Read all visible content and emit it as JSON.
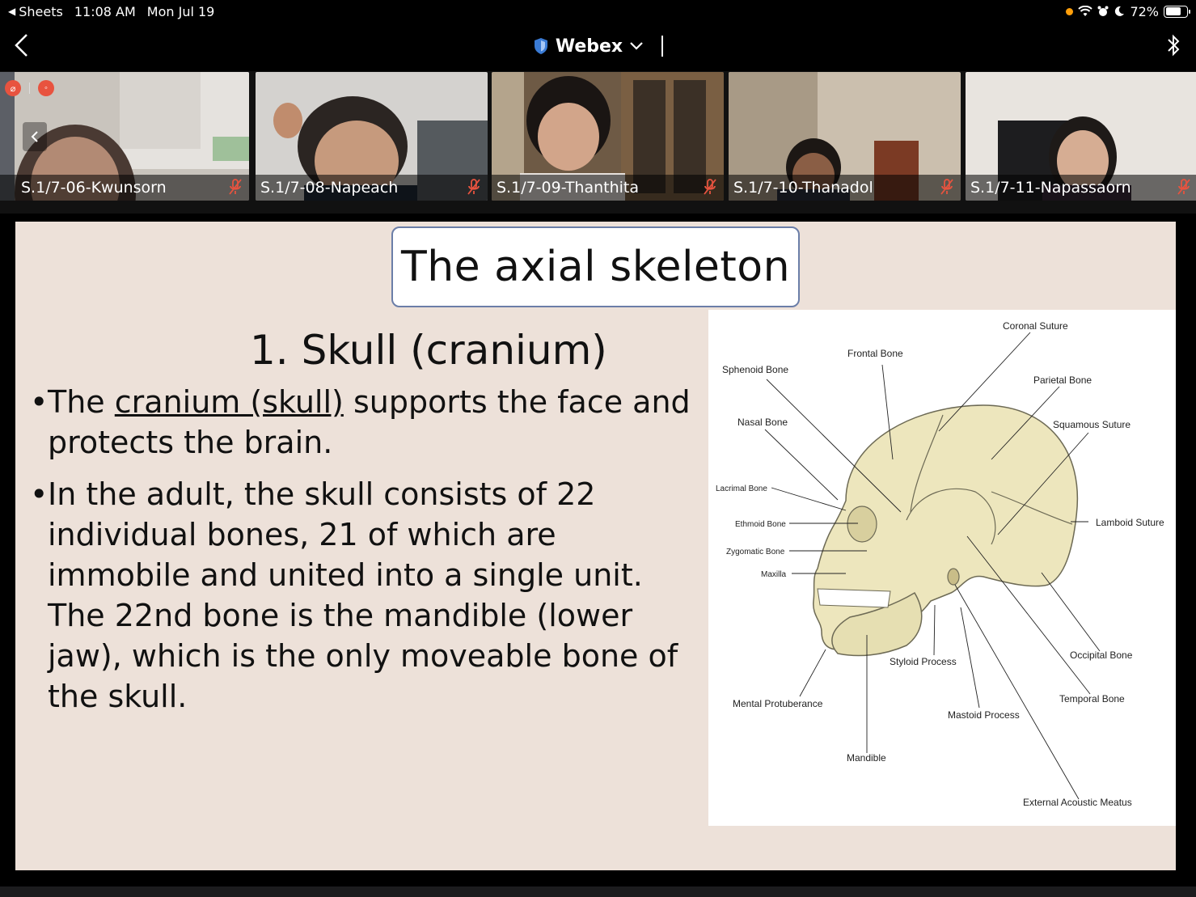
{
  "status_bar": {
    "back_app": "Sheets",
    "time": "11:08 AM",
    "date": "Mon Jul 19",
    "battery": "72%",
    "battery_level": 0.72
  },
  "header": {
    "app_title": "Webex"
  },
  "participants": [
    {
      "name": "S.1/7-06-Kwunsorn"
    },
    {
      "name": "S.1/7-08-Napeach"
    },
    {
      "name": "S.1/7-09-Thanthita"
    },
    {
      "name": "S.1/7-10-Thanadol"
    },
    {
      "name": "S.1/7-11-Napassaorn"
    }
  ],
  "slide": {
    "title": "The axial skeleton",
    "heading": "1. Skull (cranium)",
    "bullet1_pre": "The ",
    "bullet1_link": "cranium (skull)",
    "bullet1_post": " supports the face and protects the brain.",
    "bullet2": "In the adult, the skull consists of 22 individual bones, 21 of which are immobile and united into a single unit. The 22nd bone is the mandible (lower jaw), which is the only moveable bone of the skull."
  },
  "diagram_labels": {
    "coronal": "Coronal Suture",
    "frontal": "Frontal Bone",
    "sphenoid": "Sphenoid Bone",
    "parietal": "Parietal Bone",
    "nasal": "Nasal Bone",
    "squamous": "Squamous Suture",
    "lacrimal": "Lacrimal Bone",
    "ethmoid": "Ethmoid Bone",
    "lamboid": "Lamboid Suture",
    "zygomatic": "Zygomatic Bone",
    "maxilla": "Maxilla",
    "occipital": "Occipital Bone",
    "styloid": "Styloid Process",
    "temporal": "Temporal Bone",
    "mental": "Mental Protuberance",
    "mastoid": "Mastoid Process",
    "mandible": "Mandible",
    "external": "External Acoustic Meatus"
  },
  "colors": {
    "slide_bg": "#ede1d9",
    "skull": "#ede6bd",
    "mic_muted": "#e8533f",
    "title_border": "#6b7ea8"
  },
  "icons": {
    "back": "chevron-left-icon",
    "shield": "shield-icon",
    "dropdown": "chevron-down-icon",
    "bluetooth": "bluetooth-icon",
    "mic_muted": "mic-muted-icon"
  }
}
